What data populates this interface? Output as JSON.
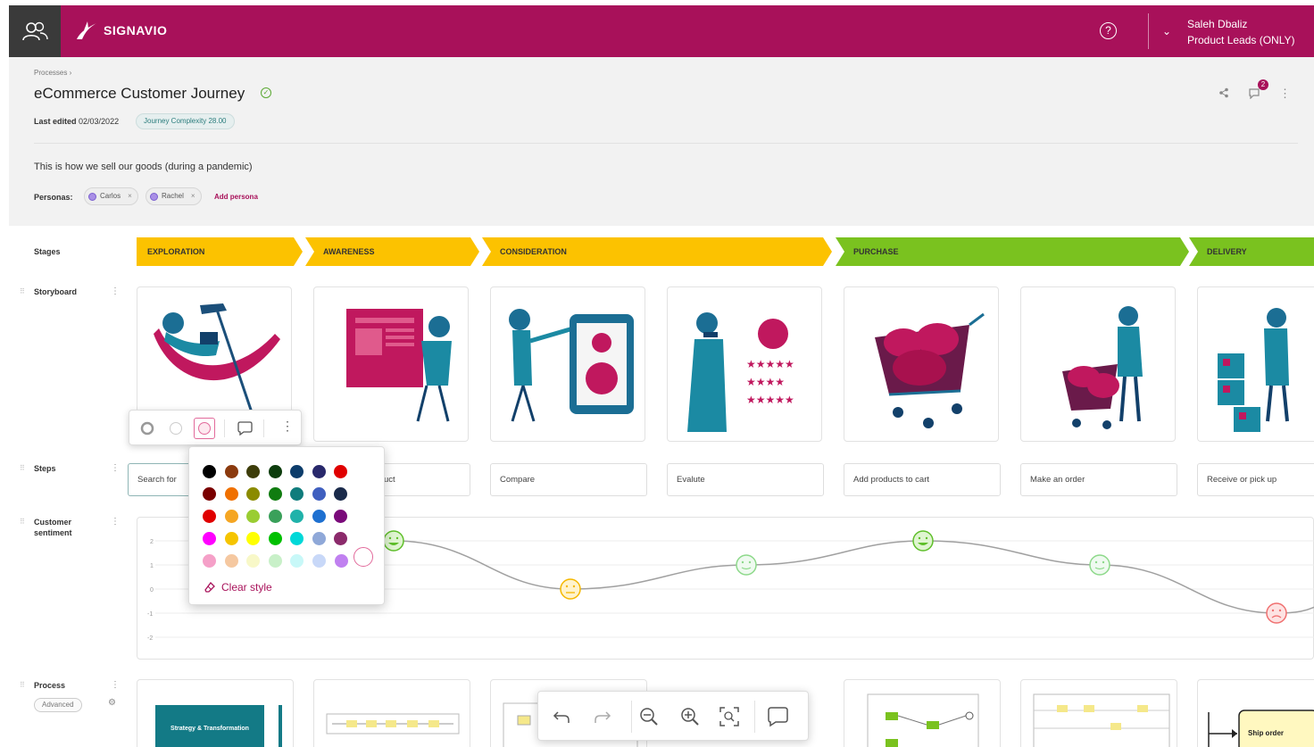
{
  "topbar": {
    "brand": "SIGNAVIO",
    "help_icon": "?",
    "user_name": "Saleh Dbaliz",
    "user_role": "Product Leads (ONLY)",
    "brand_color": "#a8115a"
  },
  "header": {
    "breadcrumb": "Processes",
    "breadcrumb_sep": "›",
    "title": "eCommerce Customer Journey",
    "last_edited_label": "Last edited",
    "last_edited_date": "02/03/2022",
    "complexity_label": "Journey Complexity 28.00",
    "description": "This is how we sell our goods (during a pandemic)",
    "personas_label": "Personas:",
    "personas": [
      "Carlos",
      "Rachel"
    ],
    "add_persona": "Add persona",
    "notification_count": "2"
  },
  "rows": {
    "stages": "Stages",
    "storyboard": "Storyboard",
    "steps": "Steps",
    "sentiment": "Customer sentiment",
    "process": "Process",
    "process_filter": "Advanced"
  },
  "stages": [
    "EXPLORATION",
    "AWARENESS",
    "CONSIDERATION",
    "PURCHASE",
    "DELIVERY"
  ],
  "steps": [
    "Search for",
    "uct",
    "Compare",
    "Evalute",
    "Add products to cart",
    "Make an order",
    "Receive or pick up"
  ],
  "sentiment_axis": [
    "2",
    "1",
    "0",
    "-1",
    "-2"
  ],
  "sentiment_values": [
    2,
    0,
    1,
    2,
    1,
    -1
  ],
  "palette": {
    "clear_style": "Clear style",
    "colors": [
      [
        "#000000",
        "#8b3a0e",
        "#3d3d0a",
        "#0d3d0d",
        "#0d3d6b",
        "#28286b",
        "#e00000"
      ],
      [
        "#7a0000",
        "#f07000",
        "#8b8b00",
        "#107c10",
        "#107c7c",
        "#3f5fbf",
        "#1a2a4a"
      ],
      [
        "#e00000",
        "#f5a623",
        "#9acd32",
        "#3aa05a",
        "#20b2aa",
        "#1e70d0",
        "#7a0a7a"
      ],
      [
        "#ff00ff",
        "#f5c400",
        "#ffff00",
        "#00c000",
        "#00d8d8",
        "#8fa8d8",
        "#8b2a6b"
      ],
      [
        "#f5a0c8",
        "#f5c8a0",
        "#f8f8c8",
        "#c8f0c8",
        "#c8f8f8",
        "#c8d8f8",
        "#c080f0"
      ]
    ]
  },
  "process_cards": {
    "card1_text": "Strategy & Transformation",
    "card7_text": "Ship order"
  }
}
